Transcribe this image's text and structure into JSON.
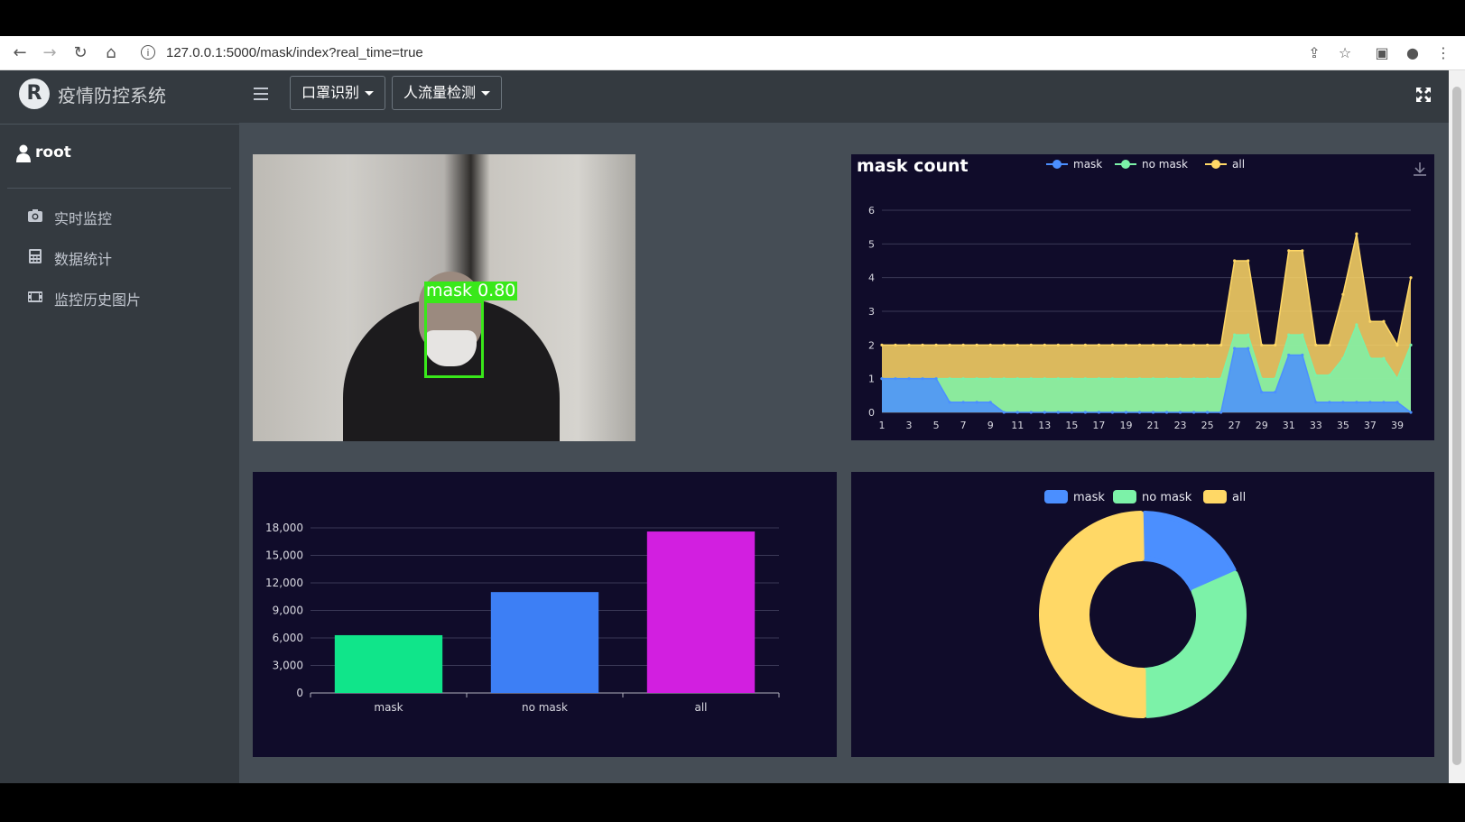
{
  "browser": {
    "url": "127.0.0.1:5000/mask/index?real_time=true"
  },
  "app": {
    "brand": "疫情防控系统",
    "brand_logo": "R",
    "user": "root",
    "nav": [
      {
        "icon": "camera-icon",
        "label": "实时监控"
      },
      {
        "icon": "calculator-icon",
        "label": "数据统计"
      },
      {
        "icon": "film-icon",
        "label": "监控历史图片"
      }
    ],
    "topbar": {
      "dropdowns": [
        "口罩识别",
        "人流量检测"
      ]
    }
  },
  "camera": {
    "detection_label": "mask 0.80"
  },
  "colors": {
    "mask": "#4b8fff",
    "no_mask": "#7cf2a8",
    "all": "#ffd866",
    "bar_mask": "#10e58a",
    "bar_no_mask": "#3d7ff5",
    "bar_all": "#d21fe0",
    "panel_bg": "#100c2a"
  },
  "chart_data": [
    {
      "type": "area",
      "title": "mask count",
      "legend": [
        "mask",
        "no mask",
        "all"
      ],
      "legend_position": "top",
      "x": [
        1,
        2,
        3,
        4,
        5,
        6,
        7,
        8,
        9,
        10,
        11,
        12,
        13,
        14,
        15,
        16,
        17,
        18,
        19,
        20,
        21,
        22,
        23,
        24,
        25,
        26,
        27,
        28,
        29,
        30,
        31,
        32,
        33,
        34,
        35,
        36,
        37,
        38,
        39,
        40
      ],
      "x_tick_labels": [
        "1",
        "3",
        "5",
        "7",
        "9",
        "11",
        "13",
        "15",
        "17",
        "19",
        "21",
        "23",
        "25",
        "27",
        "29",
        "31",
        "33",
        "35",
        "37",
        "39"
      ],
      "ylim": [
        0,
        6
      ],
      "y_ticks": [
        0,
        1,
        2,
        3,
        4,
        5,
        6
      ],
      "series": [
        {
          "name": "mask",
          "values": [
            1,
            1,
            1,
            1,
            1,
            0.3,
            0.3,
            0.3,
            0.3,
            0,
            0,
            0,
            0,
            0,
            0,
            0,
            0,
            0,
            0,
            0,
            0,
            0,
            0,
            0,
            0,
            0,
            1.9,
            1.9,
            0.6,
            0.6,
            1.7,
            1.7,
            0.3,
            0.3,
            0.3,
            0.3,
            0.3,
            0.3,
            0.3,
            0
          ]
        },
        {
          "name": "no mask",
          "values": [
            1,
            1,
            1,
            1,
            1,
            1,
            1,
            1,
            1,
            1,
            1,
            1,
            1,
            1,
            1,
            1,
            1,
            1,
            1,
            1,
            1,
            1,
            1,
            1,
            1,
            1,
            2.3,
            2.3,
            1,
            1,
            2.3,
            2.3,
            1.1,
            1.1,
            1.6,
            2.6,
            1.6,
            1.6,
            1,
            2
          ]
        },
        {
          "name": "all",
          "values": [
            2,
            2,
            2,
            2,
            2,
            2,
            2,
            2,
            2,
            2,
            2,
            2,
            2,
            2,
            2,
            2,
            2,
            2,
            2,
            2,
            2,
            2,
            2,
            2,
            2,
            2,
            4.5,
            4.5,
            2,
            2,
            4.8,
            4.8,
            2,
            2,
            3.5,
            5.3,
            2.7,
            2.7,
            2,
            4
          ]
        }
      ]
    },
    {
      "type": "bar",
      "categories": [
        "mask",
        "no mask",
        "all"
      ],
      "values": [
        6300,
        11000,
        17600
      ],
      "ylim": [
        0,
        18000
      ],
      "y_ticks": [
        "0",
        "3,000",
        "6,000",
        "9,000",
        "12,000",
        "15,000",
        "18,000"
      ]
    },
    {
      "type": "pie",
      "style": "donut",
      "legend": [
        "mask",
        "no mask",
        "all"
      ],
      "legend_position": "top",
      "values": [
        6300,
        11000,
        17600
      ]
    }
  ]
}
